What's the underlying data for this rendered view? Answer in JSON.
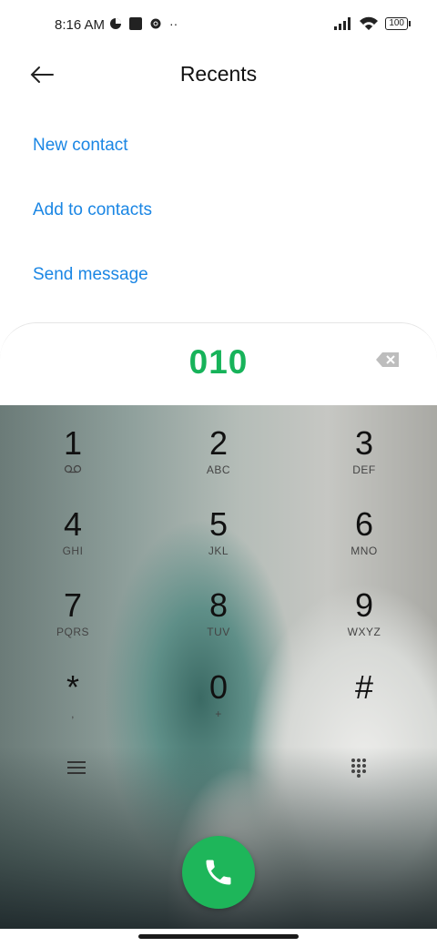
{
  "status_bar": {
    "time": "8:16 AM",
    "battery": "100"
  },
  "header": {
    "title": "Recents"
  },
  "actions": [
    {
      "label": "New contact"
    },
    {
      "label": "Add to contacts"
    },
    {
      "label": "Send message"
    }
  ],
  "dialer": {
    "number": "010"
  },
  "keys": [
    {
      "digit": "1",
      "letters": ""
    },
    {
      "digit": "2",
      "letters": "ABC"
    },
    {
      "digit": "3",
      "letters": "DEF"
    },
    {
      "digit": "4",
      "letters": "GHI"
    },
    {
      "digit": "5",
      "letters": "JKL"
    },
    {
      "digit": "6",
      "letters": "MNO"
    },
    {
      "digit": "7",
      "letters": "PQRS"
    },
    {
      "digit": "8",
      "letters": "TUV"
    },
    {
      "digit": "9",
      "letters": "WXYZ"
    },
    {
      "digit": "*",
      "letters": ","
    },
    {
      "digit": "0",
      "letters": "+"
    },
    {
      "digit": "#",
      "letters": ""
    }
  ],
  "icons": {
    "back": "back-arrow-icon",
    "backspace": "backspace-icon",
    "menu": "menu-icon",
    "dialpad": "dialpad-icon",
    "call": "phone-icon",
    "voicemail": "voicemail-icon"
  },
  "colors": {
    "accent": "#1a86e4",
    "number": "#17b35a",
    "call": "#1eb65a"
  }
}
